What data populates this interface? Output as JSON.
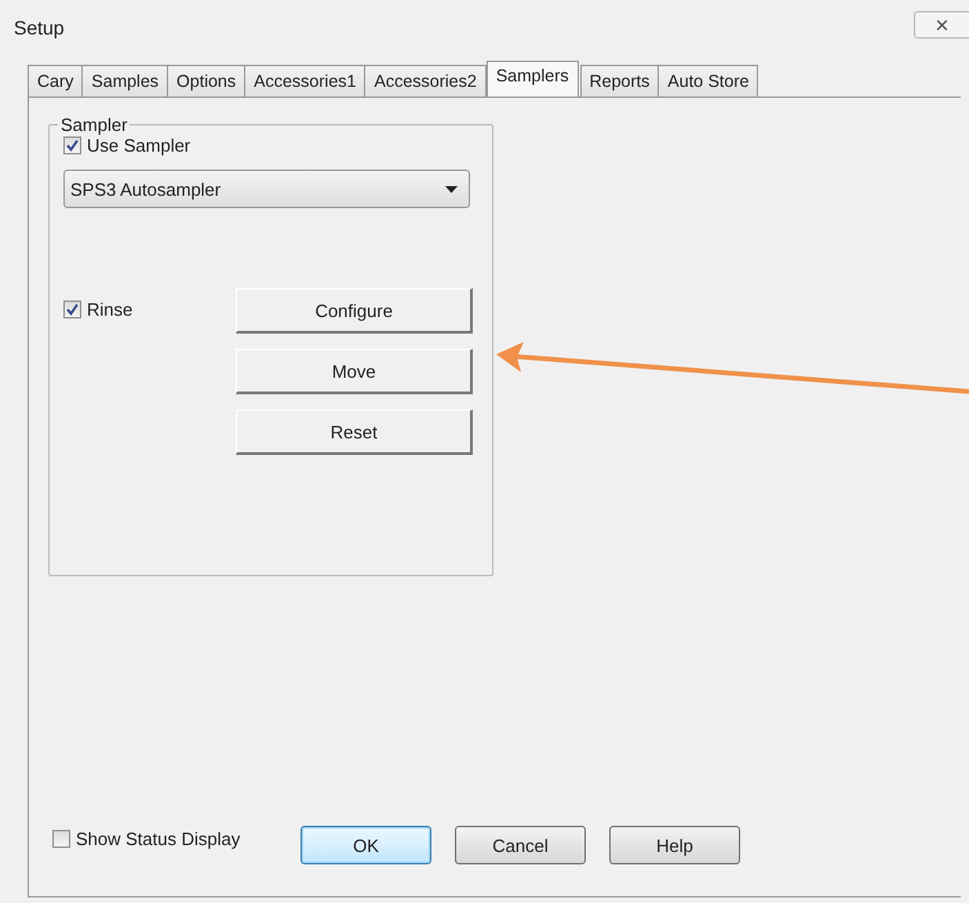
{
  "window": {
    "title": "Setup",
    "close": "✕"
  },
  "tabs": [
    {
      "label": "Cary",
      "selected": false
    },
    {
      "label": "Samples",
      "selected": false
    },
    {
      "label": "Options",
      "selected": false
    },
    {
      "label": "Accessories1",
      "selected": false
    },
    {
      "label": "Accessories2",
      "selected": false
    },
    {
      "label": "Samplers",
      "selected": true
    },
    {
      "label": "Reports",
      "selected": false
    },
    {
      "label": "Auto Store",
      "selected": false
    }
  ],
  "sampler_group": {
    "legend": "Sampler",
    "use_sampler": {
      "label": "Use Sampler",
      "checked": true
    },
    "dropdown": {
      "value": "SPS3 Autosampler"
    },
    "rinse": {
      "label": "Rinse",
      "checked": true
    },
    "buttons": [
      {
        "label": "Configure"
      },
      {
        "label": "Move"
      },
      {
        "label": "Reset"
      }
    ]
  },
  "show_status_display": {
    "label": "Show Status Display",
    "checked": false
  },
  "dialog_buttons": [
    {
      "label": "OK",
      "focused": true
    },
    {
      "label": "Cancel",
      "focused": false
    },
    {
      "label": "Help",
      "focused": false
    }
  ]
}
